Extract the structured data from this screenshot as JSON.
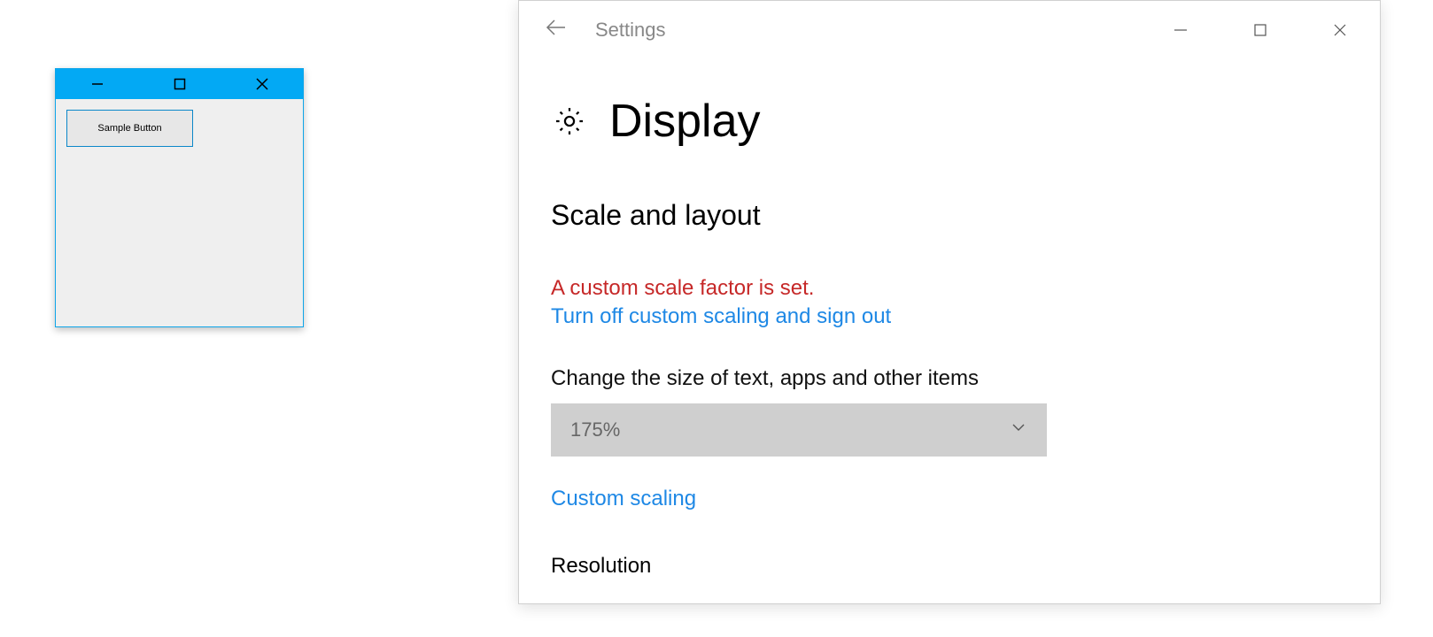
{
  "sample_app": {
    "button_label": "Sample Button"
  },
  "settings": {
    "window_title": "Settings",
    "page_title": "Display",
    "section_heading": "Scale and layout",
    "warning": "A custom scale factor is set.",
    "turn_off_link": "Turn off custom scaling and sign out",
    "size_label": "Change the size of text, apps and other items",
    "scale_dropdown_value": "175%",
    "custom_scaling_link": "Custom scaling",
    "resolution_heading": "Resolution"
  }
}
